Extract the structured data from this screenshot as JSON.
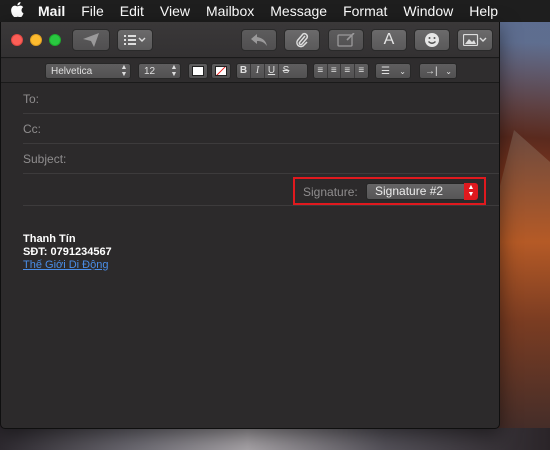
{
  "menubar": {
    "app": "Mail",
    "items": [
      "File",
      "Edit",
      "View",
      "Mailbox",
      "Message",
      "Format",
      "Window",
      "Help"
    ]
  },
  "toolbar": {
    "send_icon": "send-icon",
    "header_fields_icon": "list-icon",
    "reply_icon": "reply-icon",
    "attach_icon": "paperclip-icon",
    "annotate_icon": "annotate-icon",
    "format_label": "A",
    "emoji_icon": "emoji-icon",
    "photo_icon": "photo-icon"
  },
  "format": {
    "font": "Helvetica",
    "size": "12",
    "bold": "B",
    "italic": "I",
    "underline": "U",
    "strike": "S"
  },
  "fields": {
    "to": "To:",
    "cc": "Cc:",
    "subject": "Subject:"
  },
  "signature": {
    "label": "Signature:",
    "selected": "Signature #2"
  },
  "body": {
    "name": "Thanh Tín",
    "phone": "SĐT: 0791234567",
    "link": "Thế Giới Di Động"
  },
  "colors": {
    "highlight": "#e0191e",
    "link": "#4a8ee8",
    "window_bg": "#2c2a2b"
  }
}
